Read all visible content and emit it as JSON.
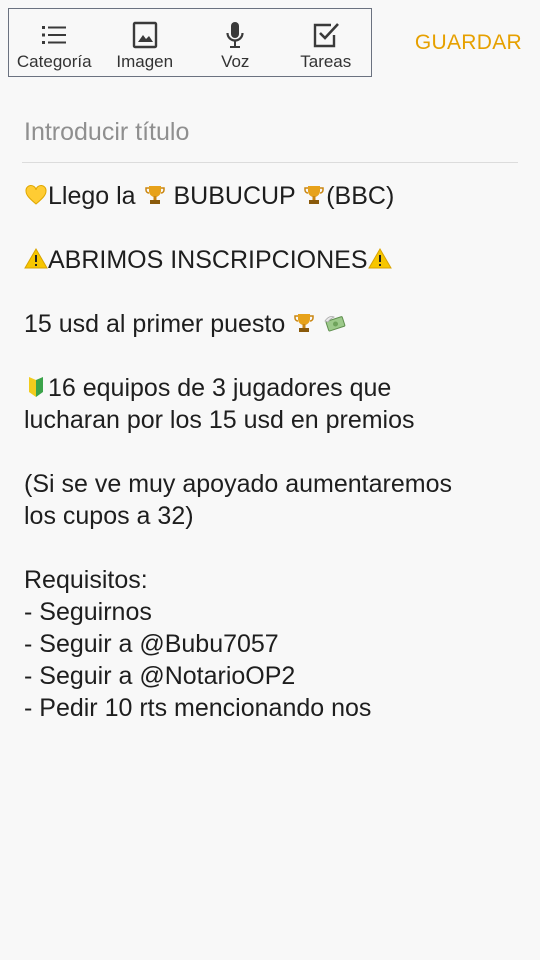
{
  "toolbar": {
    "items": [
      {
        "label": "Categoría",
        "icon": "list-icon"
      },
      {
        "label": "Imagen",
        "icon": "image-icon"
      },
      {
        "label": "Voz",
        "icon": "microphone-icon"
      },
      {
        "label": "Tareas",
        "icon": "checkbox-icon"
      }
    ],
    "save_label": "GUARDAR"
  },
  "title_input": {
    "placeholder": "Introducir título",
    "value": ""
  },
  "note": {
    "line1": {
      "a": "Llego la",
      "b": "BUBUCUP",
      "c": "(BBC)"
    },
    "line2": {
      "text": "ABRIMOS INSCRIPCIONES"
    },
    "line3": {
      "text": "15 usd al primer puesto"
    },
    "line4": {
      "text": "16 equipos de 3 jugadores que"
    },
    "line5": {
      "text": "lucharan por los 15 usd en premios"
    },
    "line6": {
      "text": "(Si se ve muy apoyado aumentaremos"
    },
    "line7": {
      "text": "los cupos a 32)"
    },
    "line8": {
      "text": "Requisitos:"
    },
    "line9": {
      "text": "- Seguirnos"
    },
    "line10": {
      "text": "- Seguir a @Bubu7057"
    },
    "line11": {
      "text": "- Seguir a @NotarioOP2"
    },
    "line12": {
      "text": "- Pedir 10 rts mencionando nos"
    }
  },
  "emoji": {
    "heart": "yellow-heart-icon",
    "trophy": "trophy-icon",
    "warning": "warning-icon",
    "money": "money-with-wings-icon",
    "beginner": "beginner-icon"
  },
  "colors": {
    "accent": "#e6a000",
    "background": "#f8f8f8"
  }
}
